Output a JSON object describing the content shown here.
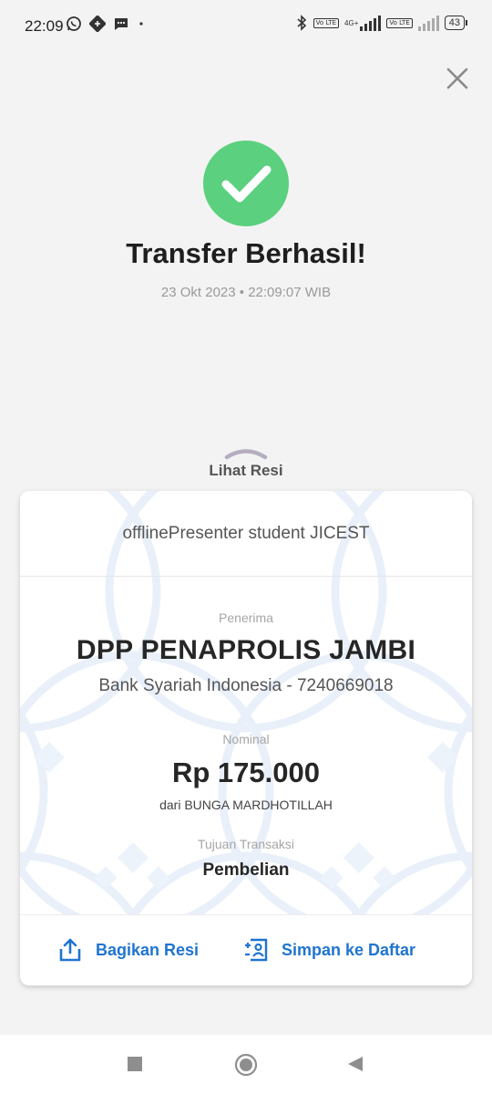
{
  "status_bar": {
    "time": "22:09",
    "network_label": "4G+",
    "volte_label": "Vo LTE",
    "battery": "43"
  },
  "header": {
    "title": "Transfer Berhasil!",
    "timestamp": "23 Okt 2023 • 22:09:07 WIB"
  },
  "receipt_toggle": {
    "label": "Lihat Resi"
  },
  "receipt": {
    "reference": "offlinePresenter student  JICEST",
    "recipient_label": "Penerima",
    "recipient_name": "DPP PENAPROLIS JAMBI",
    "recipient_bank": "Bank Syariah Indonesia - 7240669018",
    "amount_label": "Nominal",
    "amount": "Rp 175.000",
    "sender": "dari BUNGA MARDHOTILLAH",
    "purpose_label": "Tujuan Transaksi",
    "purpose": "Pembelian"
  },
  "actions": {
    "share_label": "Bagikan Resi",
    "save_label": "Simpan ke Daftar"
  },
  "icons": {
    "close": "close-icon",
    "success": "check-circle-icon",
    "share": "share-icon",
    "save": "contact-add-icon",
    "nav_recent": "square-icon",
    "nav_home": "circle-icon",
    "nav_back": "triangle-back-icon"
  },
  "colors": {
    "success": "#5bd07e",
    "accent": "#1f74d1",
    "background": "#f3f3f3"
  }
}
